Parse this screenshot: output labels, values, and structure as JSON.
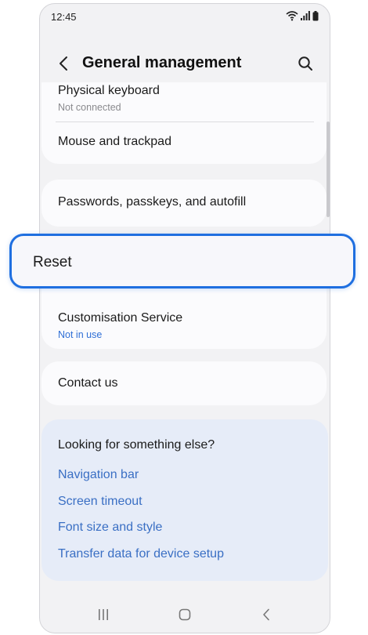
{
  "status_bar": {
    "time": "12:45",
    "icons": [
      "wifi-icon",
      "signal-icon",
      "battery-icon"
    ]
  },
  "header": {
    "title": "General management",
    "back_icon": "chevron-left-icon",
    "search_icon": "search-icon"
  },
  "items": {
    "physical_keyboard": {
      "title": "Physical keyboard",
      "subtitle": "Not connected"
    },
    "mouse_trackpad": {
      "title": "Mouse and trackpad"
    },
    "passwords": {
      "title": "Passwords, passkeys, and autofill"
    },
    "reset": {
      "title": "Reset"
    },
    "customisation": {
      "title": "Customisation Service",
      "subtitle": "Not in use"
    },
    "contact": {
      "title": "Contact us"
    }
  },
  "suggestions": {
    "title": "Looking for something else?",
    "links": [
      "Navigation bar",
      "Screen timeout",
      "Font size and style",
      "Transfer data for device setup"
    ]
  },
  "nav_bar": {
    "icons": [
      "recent-apps-icon",
      "home-icon",
      "back-icon"
    ]
  },
  "colors": {
    "highlight_border": "#1f6fe0",
    "link": "#3a6fc4",
    "subtitle_blue": "#2f6fd6",
    "suggest_background": "#e6ecf8",
    "card_background": "#fbfbfd",
    "screen_background": "#f2f2f4"
  }
}
